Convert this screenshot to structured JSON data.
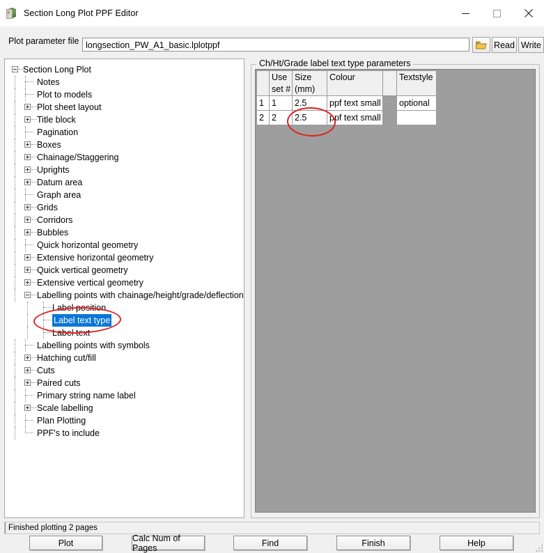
{
  "window": {
    "title": "Section Long Plot PPF Editor",
    "icon": "app-cube-icon",
    "minimize_label": "minimize-icon",
    "maximize_label": "maximize-icon",
    "close_label": "close-icon"
  },
  "file_row": {
    "label": "Plot parameter file",
    "value": "longsection_PW_A1_basic.lplotppf",
    "placeholder": "",
    "browse_icon": "folder-open-icon",
    "read_label": "Read",
    "write_label": "Write"
  },
  "tree": {
    "selected": "Label text type",
    "items": [
      {
        "label": "Section Long Plot",
        "depth": 0,
        "toggle": "minus"
      },
      {
        "label": "Notes",
        "depth": 1,
        "toggle": "none"
      },
      {
        "label": "Plot to models",
        "depth": 1,
        "toggle": "none"
      },
      {
        "label": "Plot sheet layout",
        "depth": 1,
        "toggle": "plus"
      },
      {
        "label": "Title block",
        "depth": 1,
        "toggle": "plus"
      },
      {
        "label": "Pagination",
        "depth": 1,
        "toggle": "none"
      },
      {
        "label": "Boxes",
        "depth": 1,
        "toggle": "plus"
      },
      {
        "label": "Chainage/Staggering",
        "depth": 1,
        "toggle": "plus"
      },
      {
        "label": "Uprights",
        "depth": 1,
        "toggle": "plus"
      },
      {
        "label": "Datum area",
        "depth": 1,
        "toggle": "plus"
      },
      {
        "label": "Graph area",
        "depth": 1,
        "toggle": "none"
      },
      {
        "label": "Grids",
        "depth": 1,
        "toggle": "plus"
      },
      {
        "label": "Corridors",
        "depth": 1,
        "toggle": "plus"
      },
      {
        "label": "Bubbles",
        "depth": 1,
        "toggle": "plus"
      },
      {
        "label": "Quick horizontal geometry",
        "depth": 1,
        "toggle": "none"
      },
      {
        "label": "Extensive horizontal geometry",
        "depth": 1,
        "toggle": "plus"
      },
      {
        "label": "Quick vertical geometry",
        "depth": 1,
        "toggle": "plus"
      },
      {
        "label": "Extensive vertical geometry",
        "depth": 1,
        "toggle": "plus"
      },
      {
        "label": "Labelling points with chainage/height/grade/deflection",
        "depth": 1,
        "toggle": "minus"
      },
      {
        "label": "Label position",
        "depth": 2,
        "toggle": "none"
      },
      {
        "label": "Label text type",
        "depth": 2,
        "toggle": "none",
        "selected": true
      },
      {
        "label": "Label text",
        "depth": 2,
        "toggle": "none"
      },
      {
        "label": "Labelling points with symbols",
        "depth": 1,
        "toggle": "none"
      },
      {
        "label": "Hatching cut/fill",
        "depth": 1,
        "toggle": "plus"
      },
      {
        "label": "Cuts",
        "depth": 1,
        "toggle": "plus"
      },
      {
        "label": "Paired cuts",
        "depth": 1,
        "toggle": "plus"
      },
      {
        "label": "Primary string name label",
        "depth": 1,
        "toggle": "none"
      },
      {
        "label": "Scale labelling",
        "depth": 1,
        "toggle": "plus"
      },
      {
        "label": "Plan Plotting",
        "depth": 1,
        "toggle": "none"
      },
      {
        "label": "PPF's to include",
        "depth": 1,
        "toggle": "none"
      }
    ]
  },
  "panel": {
    "group_title": "Ch/Ht/Grade label text type parameters",
    "grid": {
      "columns": [
        "",
        "Use\nset #",
        "Size\n(mm)",
        "Colour",
        "",
        "Textstyle"
      ],
      "headers": [
        {
          "line1": "",
          "line2": ""
        },
        {
          "line1": "Use",
          "line2": "set #"
        },
        {
          "line1": "Size",
          "line2": "(mm)"
        },
        {
          "line1": "Colour",
          "line2": ""
        },
        {
          "line1": "",
          "line2": ""
        },
        {
          "line1": "Textstyle",
          "line2": ""
        }
      ],
      "rows": [
        {
          "row_number": "1",
          "use_set": "1",
          "size_mm": "2.5",
          "colour": "ppf text small",
          "swatch_color": "#9e9e9e",
          "textstyle": "optional",
          "textstyle_is_placeholder": true,
          "size_selected": false
        },
        {
          "row_number": "2",
          "use_set": "2",
          "size_mm": "2.5",
          "colour": "ppf text small",
          "swatch_color": "#9e9e9e",
          "textstyle": "",
          "textstyle_is_placeholder": false,
          "size_selected": true
        }
      ]
    }
  },
  "annotations": {
    "tree_highlight": "red-ellipse-around-label-text-type",
    "cell_highlight": "red-ellipse-around-size-cell",
    "color": "#e02020"
  },
  "status": {
    "message": "Finished plotting 2 pages"
  },
  "footer": {
    "buttons": [
      {
        "label": "Plot"
      },
      {
        "label": "Calc Num of Pages"
      },
      {
        "label": "Find"
      },
      {
        "label": "Finish"
      },
      {
        "label": "Help"
      }
    ],
    "resize_grip": "resize-grip-icon"
  },
  "colors": {
    "selection_blue": "#0a76d6",
    "panel_gray": "#9e9e9e",
    "window_bg": "#f0f0f0",
    "annotation_red": "#e02020"
  }
}
